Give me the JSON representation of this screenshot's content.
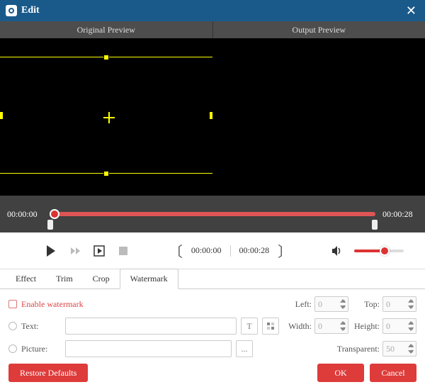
{
  "window": {
    "title": "Edit"
  },
  "preview": {
    "original_label": "Original Preview",
    "output_label": "Output Preview"
  },
  "timeline": {
    "start": "00:00:00",
    "end": "00:00:28",
    "pos": "00:00:00",
    "total": "00:00:28"
  },
  "tabs": {
    "effect": "Effect",
    "trim": "Trim",
    "crop": "Crop",
    "watermark": "Watermark"
  },
  "watermark": {
    "enable": "Enable watermark",
    "text_label": "Text:",
    "picture_label": "Picture:",
    "browse": "...",
    "left_label": "Left:",
    "left_val": "0",
    "top_label": "Top:",
    "top_val": "0",
    "width_label": "Width:",
    "width_val": "0",
    "height_label": "Height:",
    "height_val": "0",
    "transparent_label": "Transparent:",
    "transparent_val": "50"
  },
  "footer": {
    "restore": "Restore Defaults",
    "ok": "OK",
    "cancel": "Cancel"
  }
}
